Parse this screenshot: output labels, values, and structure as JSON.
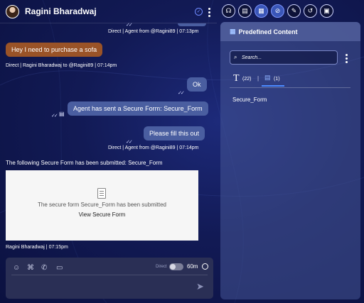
{
  "header": {
    "contact_name": "Ragini Bharadwaj",
    "verified_icon": "verified-icon"
  },
  "toolbar": {
    "buttons": [
      {
        "name": "support-agent-icon",
        "glyph": "☊"
      },
      {
        "name": "id-card-icon",
        "glyph": "▤"
      },
      {
        "name": "predefined-content-icon",
        "glyph": "▦",
        "active": true
      },
      {
        "name": "compass-icon",
        "glyph": "⊘",
        "active": true
      },
      {
        "name": "note-edit-icon",
        "glyph": "✎"
      },
      {
        "name": "history-icon",
        "glyph": "↺"
      },
      {
        "name": "clipboard-icon",
        "glyph": "▣"
      }
    ]
  },
  "messages": {
    "meta_top": "Direct  |  Agent from @Ragini89  |  07:13pm",
    "incoming_text": "Hey I need to purchase a sofa",
    "incoming_meta": "Direct  |  Ragini Bharadwaj to @Ragini89  |  07:14pm",
    "ok_text": "Ok",
    "secure_form_sent_text": "Agent has sent a Secure Form: Secure_Form",
    "fill_text": "Please fill this out",
    "fill_meta": "Direct  |  Agent from @Ragini89  |  07:14pm",
    "submitted_notice": "The following Secure Form has been submitted: Secure_Form",
    "form_card_line1": "The secure form Secure_Form has been submitted",
    "form_card_link": "View Secure Form",
    "submitted_meta": "Ragini Bharadwaj  |  07:15pm"
  },
  "composer": {
    "direct_label": "Direct",
    "timer_label": "60m"
  },
  "panel": {
    "title": "Predefined Content",
    "search_placeholder": "Search...",
    "text_tab_glyph": "T",
    "text_tab_count": "(22)",
    "separator": "|",
    "form_tab_count": "(1)",
    "items": [
      "Secure_Form"
    ]
  },
  "colors": {
    "background": "#121a55",
    "incoming_bubble": "#9a5327",
    "outgoing_bubble": "#4a5ea0",
    "accent": "#4c8bff"
  }
}
